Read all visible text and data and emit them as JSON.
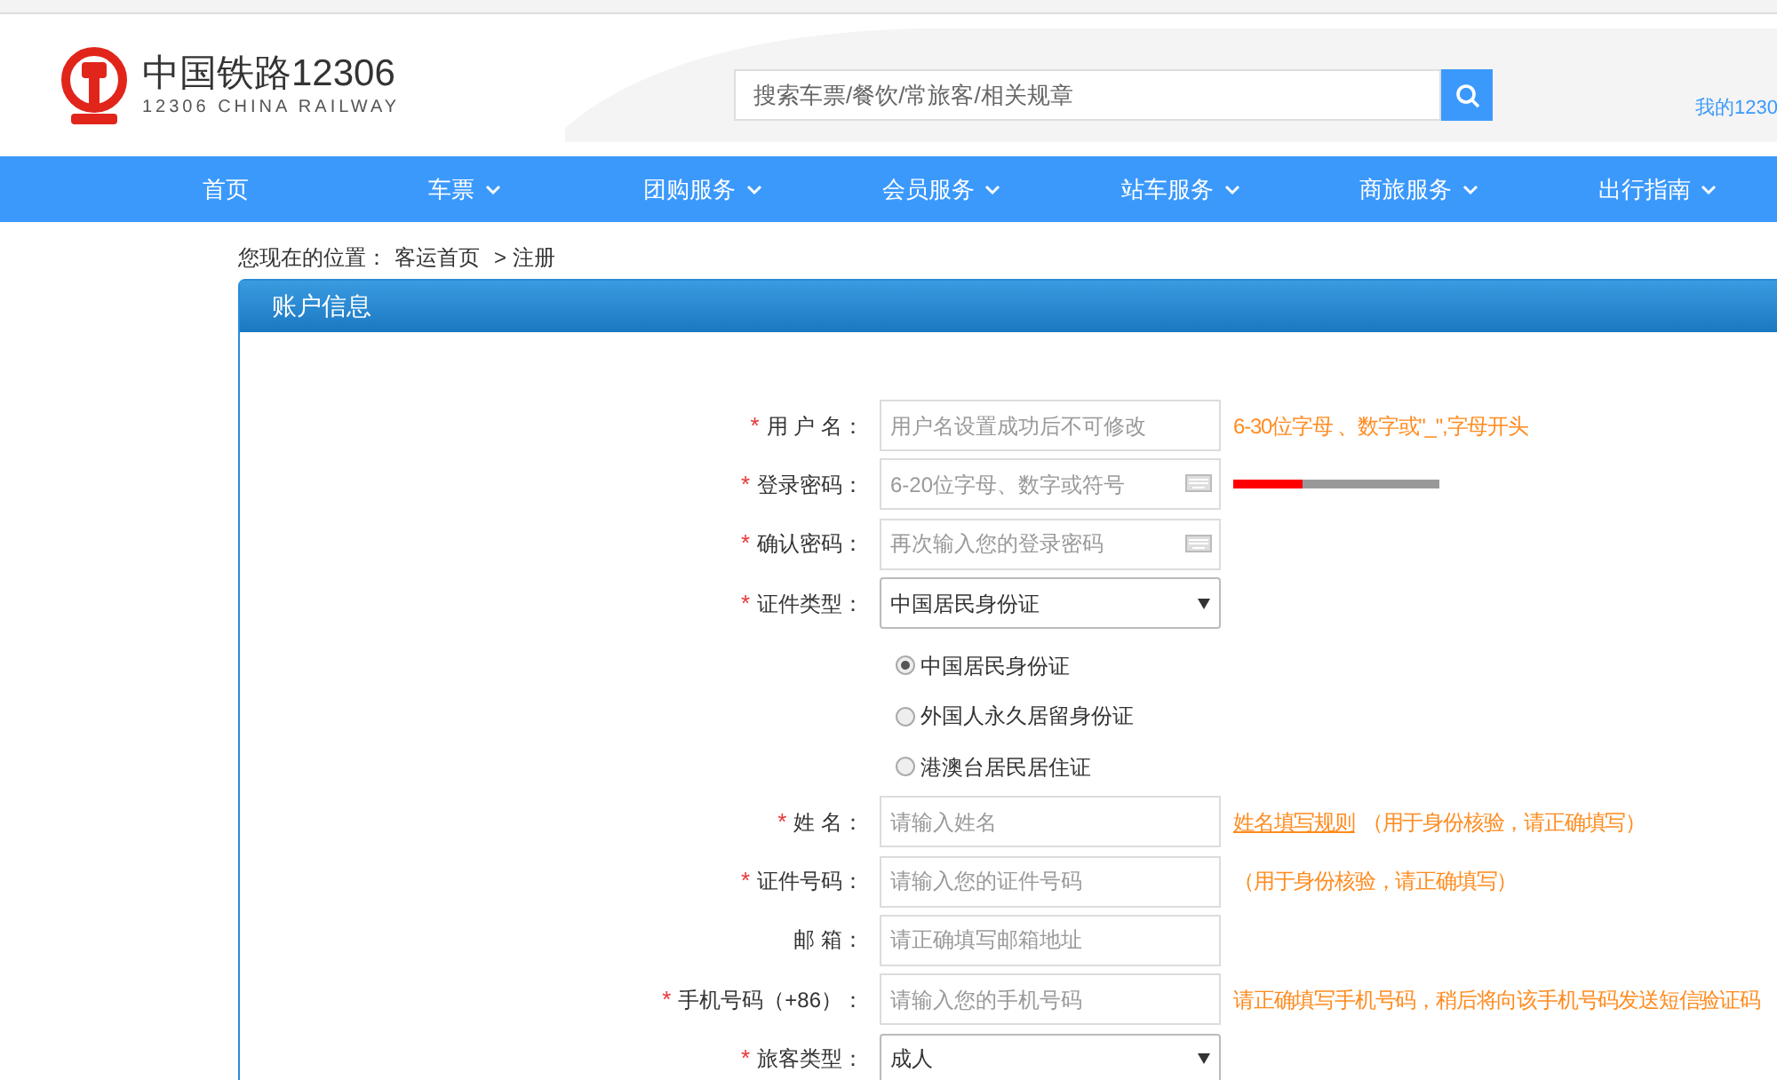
{
  "header": {
    "logo_title": "中国铁路12306",
    "logo_subtitle": "12306 CHINA RAILWAY",
    "search": {
      "placeholder": "搜索车票/餐饮/常旅客/相关规章"
    },
    "account_link": "我的1230"
  },
  "nav": [
    {
      "label": "首页",
      "dropdown": false
    },
    {
      "label": "车票",
      "dropdown": true
    },
    {
      "label": "团购服务",
      "dropdown": true
    },
    {
      "label": "会员服务",
      "dropdown": true
    },
    {
      "label": "站车服务",
      "dropdown": true
    },
    {
      "label": "商旅服务",
      "dropdown": true
    },
    {
      "label": "出行指南",
      "dropdown": true
    }
  ],
  "breadcrumb": {
    "prefix": "您现在的位置：",
    "home": "客运首页",
    "current": "> 注册"
  },
  "panel": {
    "title": "账户信息"
  },
  "fields": [
    {
      "kind": "text",
      "required_mark": "*",
      "label": "用 户 名：",
      "placeholder": "用户名设置成功后不可修改",
      "hint": "6-30位字母 、数字或\"_\",字母开头"
    },
    {
      "kind": "password",
      "required_mark": "*",
      "label": "登录密码：",
      "placeholder": "6-20位字母、数字或符号",
      "strength": {
        "level": 0.333
      }
    },
    {
      "kind": "password",
      "required_mark": "*",
      "label": "确认密码：",
      "placeholder": "再次输入您的登录密码"
    },
    {
      "kind": "select",
      "required_mark": "*",
      "label": "证件类型：",
      "value": "中国居民身份证"
    },
    {
      "kind": "radios",
      "options": [
        {
          "label": "中国居民身份证",
          "selected": true
        },
        {
          "label": "外国人永久居留身份证",
          "selected": false
        },
        {
          "label": "港澳台居民居住证",
          "selected": false
        }
      ]
    },
    {
      "kind": "text",
      "required_mark": "*",
      "label": "姓 名：",
      "placeholder": "请输入姓名",
      "hint_link": "姓名填写规则",
      "hint": "（用于身份核验，请正确填写）"
    },
    {
      "kind": "text",
      "required_mark": "*",
      "label": "证件号码：",
      "placeholder": "请输入您的证件号码",
      "hint": "（用于身份核验，请正确填写）"
    },
    {
      "kind": "text",
      "label": "邮 箱：",
      "placeholder": "请正确填写邮箱地址"
    },
    {
      "kind": "text",
      "required_mark": "*",
      "label": "手机号码（+86）：",
      "placeholder": "请输入您的手机号码",
      "hint": "请正确填写手机号码，稍后将向该手机号码发送短信验证码"
    },
    {
      "kind": "select",
      "required_mark": "*",
      "label": "旅客类型：",
      "value": "成人"
    }
  ]
}
